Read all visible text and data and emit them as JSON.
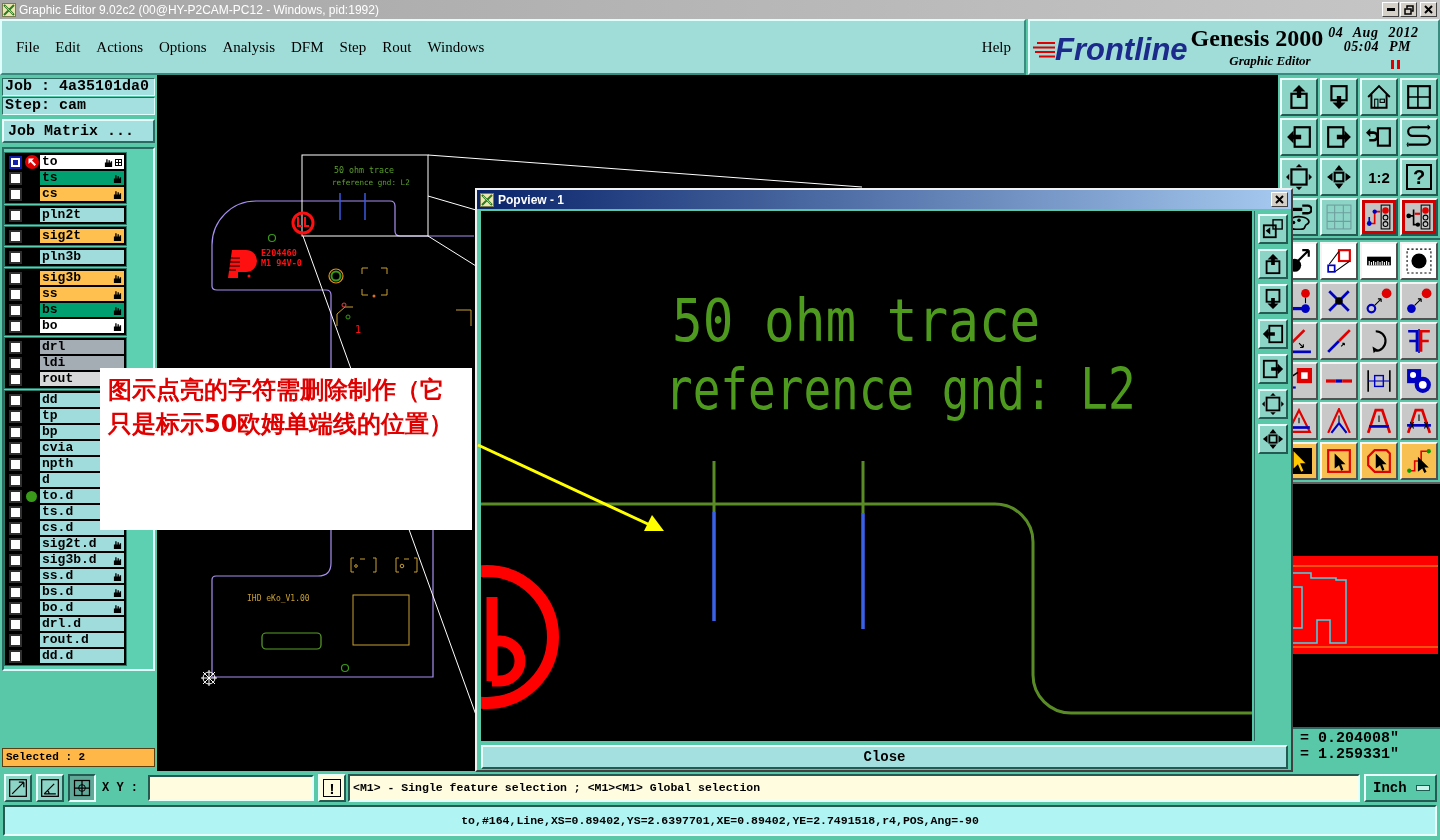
{
  "window": {
    "title": "Graphic Editor 9.02c2 (00@HY-P2CAM-PC12 - Windows, pid:1992)"
  },
  "menu": {
    "items": [
      "File",
      "Edit",
      "Actions",
      "Options",
      "Analysis",
      "DFM",
      "Step",
      "Rout",
      "Windows"
    ],
    "help": "Help"
  },
  "brand": {
    "logo": "Frontline",
    "product": "Genesis 2000",
    "module": "Graphic Editor",
    "date": "04 Aug 2012",
    "time": "05:04 PM"
  },
  "job": {
    "job": "Job : 4a35101da0",
    "step": "Step: cam",
    "matrix_button": "Job Matrix ..."
  },
  "layer_groups": [
    {
      "layers": [
        {
          "name": "to",
          "color": "#ffffff",
          "selected": true,
          "work": true,
          "affected": true,
          "features_selected": true,
          "displayed": false
        },
        {
          "name": "ts",
          "color": "#00a070",
          "selected": false,
          "work": false,
          "affected": true,
          "features_selected": false,
          "displayed": false
        },
        {
          "name": "cs",
          "color": "#ffc050",
          "selected": false,
          "work": false,
          "affected": true,
          "features_selected": false,
          "displayed": false
        }
      ]
    },
    {
      "layers": [
        {
          "name": "pln2t",
          "color": "#a0dcdc",
          "selected": false,
          "work": false,
          "affected": false,
          "features_selected": false,
          "displayed": false
        }
      ]
    },
    {
      "layers": [
        {
          "name": "sig2t",
          "color": "#ffc050",
          "selected": false,
          "work": false,
          "affected": true,
          "features_selected": false,
          "displayed": false
        }
      ]
    },
    {
      "layers": [
        {
          "name": "pln3b",
          "color": "#a0dcdc",
          "selected": false,
          "work": false,
          "affected": false,
          "features_selected": false,
          "displayed": false
        }
      ]
    },
    {
      "layers": [
        {
          "name": "sig3b",
          "color": "#ffc050",
          "selected": false,
          "work": false,
          "affected": true,
          "features_selected": false,
          "displayed": false
        },
        {
          "name": "ss",
          "color": "#ffc050",
          "selected": false,
          "work": false,
          "affected": true,
          "features_selected": false,
          "displayed": false
        },
        {
          "name": "bs",
          "color": "#00a070",
          "selected": false,
          "work": false,
          "affected": true,
          "features_selected": false,
          "displayed": false
        },
        {
          "name": "bo",
          "color": "#ffffff",
          "selected": false,
          "work": false,
          "affected": true,
          "features_selected": false,
          "displayed": false
        }
      ]
    },
    {
      "layers": [
        {
          "name": "drl",
          "color": "#a4acb4",
          "selected": false,
          "work": false,
          "affected": false,
          "features_selected": false,
          "displayed": false
        },
        {
          "name": "ldi",
          "color": "#a4acb4",
          "selected": false,
          "work": false,
          "affected": false,
          "features_selected": false,
          "displayed": false
        },
        {
          "name": "rout",
          "color": "#d8d8d8",
          "selected": false,
          "work": false,
          "affected": false,
          "features_selected": false,
          "displayed": false
        }
      ]
    },
    {
      "layers": [
        {
          "name": "dd",
          "color": "#a0dcdc",
          "selected": false,
          "work": false,
          "affected": false,
          "features_selected": false,
          "displayed": false
        },
        {
          "name": "tp",
          "color": "#a0dcdc",
          "selected": false,
          "work": false,
          "affected": false,
          "features_selected": false,
          "displayed": false
        },
        {
          "name": "bp",
          "color": "#a0dcdc",
          "selected": false,
          "work": false,
          "affected": false,
          "features_selected": false,
          "displayed": false
        },
        {
          "name": "cvia",
          "color": "#a0dcdc",
          "selected": false,
          "work": false,
          "affected": false,
          "features_selected": false,
          "displayed": false
        },
        {
          "name": "npth",
          "color": "#a0dcdc",
          "selected": false,
          "work": false,
          "affected": false,
          "features_selected": false,
          "displayed": false
        },
        {
          "name": "d",
          "color": "#a0dcdc",
          "selected": false,
          "work": false,
          "affected": false,
          "features_selected": false,
          "displayed": false
        },
        {
          "name": "to.d",
          "color": "#a0dcdc",
          "selected": false,
          "work": false,
          "affected": false,
          "features_selected": false,
          "displayed": true
        },
        {
          "name": "ts.d",
          "color": "#a0dcdc",
          "selected": false,
          "work": false,
          "affected": false,
          "features_selected": false,
          "displayed": false
        },
        {
          "name": "cs.d",
          "color": "#a0dcdc",
          "selected": false,
          "work": false,
          "affected": false,
          "features_selected": false,
          "displayed": false
        },
        {
          "name": "sig2t.d",
          "color": "#a0dcdc",
          "selected": false,
          "work": false,
          "affected": true,
          "features_selected": false,
          "displayed": false
        },
        {
          "name": "sig3b.d",
          "color": "#a0dcdc",
          "selected": false,
          "work": false,
          "affected": true,
          "features_selected": false,
          "displayed": false
        },
        {
          "name": "ss.d",
          "color": "#a0dcdc",
          "selected": false,
          "work": false,
          "affected": true,
          "features_selected": false,
          "displayed": false
        },
        {
          "name": "bs.d",
          "color": "#a0dcdc",
          "selected": false,
          "work": false,
          "affected": true,
          "features_selected": false,
          "displayed": false
        },
        {
          "name": "bo.d",
          "color": "#a0dcdc",
          "selected": false,
          "work": false,
          "affected": true,
          "features_selected": false,
          "displayed": false
        },
        {
          "name": "drl.d",
          "color": "#a0dcdc",
          "selected": false,
          "work": false,
          "affected": false,
          "features_selected": false,
          "displayed": false
        },
        {
          "name": "rout.d",
          "color": "#a0dcdc",
          "selected": false,
          "work": false,
          "affected": false,
          "features_selected": false,
          "displayed": false
        },
        {
          "name": "dd.d",
          "color": "#a0dcdc",
          "selected": false,
          "work": false,
          "affected": false,
          "features_selected": false,
          "displayed": false
        }
      ]
    }
  ],
  "selection_count": "Selected : 2",
  "canvas": {
    "callout": [
      "50 ohm trace",
      "reference gnd: L2"
    ],
    "marking": [
      "E204460",
      "M1 94V-0"
    ],
    "board_label": "IHD eKo_V1.00",
    "pin_label": "1"
  },
  "toolbar": {
    "scale_button": "1:2",
    "help_button": "?"
  },
  "coordinates": [
    "= 0.204008\"",
    "= 1.259331\""
  ],
  "popview": {
    "title": "Popview - 1",
    "lines": [
      "50 ohm trace",
      "reference gnd: L2"
    ],
    "close_button": "Close"
  },
  "annotation": {
    "text": "图示点亮的字符需删除制作（它只是标示50欧姆单端线的位置）"
  },
  "command_bar": {
    "tools": [
      {
        "pressed": false
      },
      {
        "pressed": false
      },
      {
        "pressed": true
      }
    ],
    "xy_label": "X Y :",
    "confirm_button": "!",
    "hint": "<M1> - Single feature selection ; <M1><M1> Global selection",
    "units": "Inch"
  },
  "status_bar": "to,#164,Line,XS=0.89402,YS=2.6397701,XE=0.89402,YE=2.7491518,r4,POS,Ang=-90"
}
